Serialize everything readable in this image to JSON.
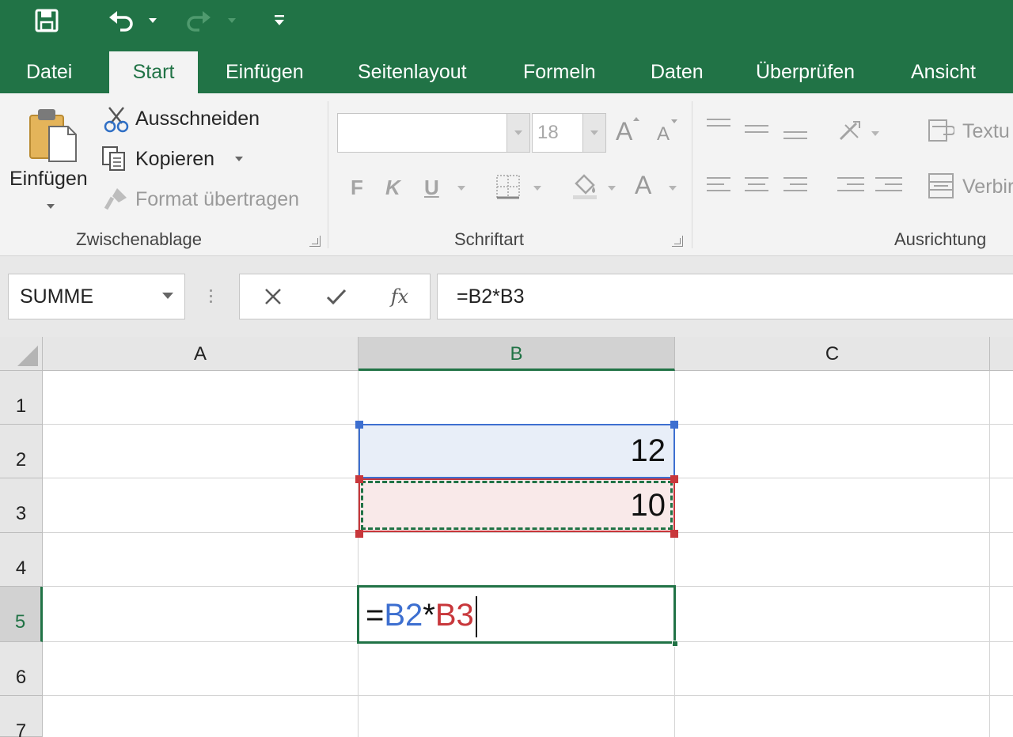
{
  "qat": {
    "save_icon": "save-icon",
    "undo_icon": "undo-icon",
    "redo_icon": "redo-icon",
    "customize_icon": "customize-qat-icon"
  },
  "tabs": [
    "Datei",
    "Start",
    "Einfügen",
    "Seitenlayout",
    "Formeln",
    "Daten",
    "Überprüfen",
    "Ansicht"
  ],
  "active_tab": "Start",
  "clipboard": {
    "paste_label": "Einfügen",
    "cut_label": "Ausschneiden",
    "copy_label": "Kopieren",
    "format_painter_label": "Format übertragen",
    "group_label": "Zwischenablage"
  },
  "font": {
    "font_name": "",
    "font_size": "18",
    "grow_label": "A",
    "shrink_label": "A",
    "bold_label": "F",
    "italic_label": "K",
    "underline_label": "U",
    "font_color_label": "A",
    "group_label": "Schriftart"
  },
  "alignment": {
    "wrap_label": "Textu",
    "merge_label": "Verbir",
    "group_label": "Ausrichtung"
  },
  "formula_bar": {
    "name_box": "SUMME",
    "formula": "=B2*B3",
    "fx_label": "fx"
  },
  "sheet": {
    "columns": [
      "A",
      "B",
      "C"
    ],
    "selected_column": "B",
    "rows": [
      "1",
      "2",
      "3",
      "4",
      "5",
      "6",
      "7"
    ],
    "selected_row": "5",
    "cells": {
      "B2": "12",
      "B3": "10"
    },
    "editing_cell": {
      "address": "B5",
      "eq": "=",
      "ref1": "B2",
      "op": "*",
      "ref2": "B3"
    }
  },
  "colors": {
    "accent": "#217346",
    "ref1": "#3d6fd0",
    "ref2": "#c8373b"
  }
}
